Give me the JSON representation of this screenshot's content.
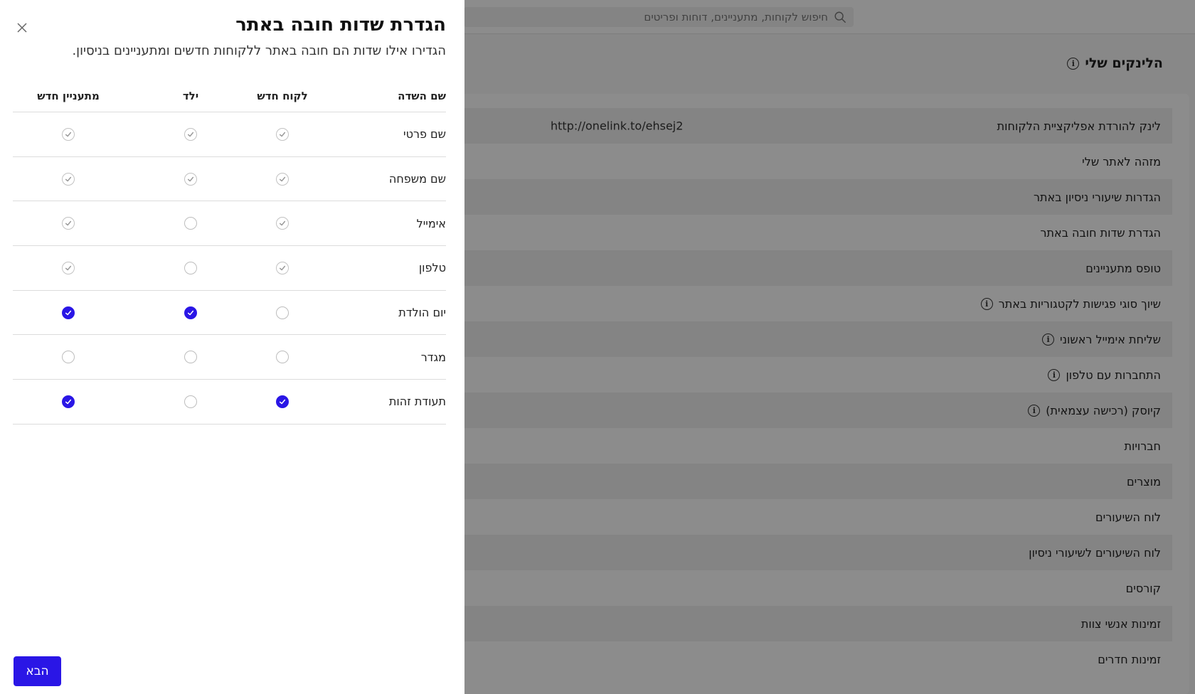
{
  "search": {
    "placeholder": "חיפוש לקוחות, מתעניינים, דוחות ופריטים"
  },
  "background": {
    "heading": "הלינקים שלי",
    "rows": [
      {
        "label": "לינק להורדת אפליקציית הלקוחות",
        "value": "http://onelink.to/ehsej2",
        "info": false
      },
      {
        "label": "מזהה לאתר שלי",
        "value": "",
        "info": false
      },
      {
        "label": "הגדרות שיעורי ניסיון באתר",
        "value": "",
        "info": false
      },
      {
        "label": "הגדרת שדות חובה באתר",
        "value": "",
        "info": false
      },
      {
        "label": "טופס מתעניינים",
        "value": "",
        "info": false
      },
      {
        "label": "שיוך סוגי פגישות לקטגוריות באתר",
        "value": "",
        "info": true
      },
      {
        "label": "שליחת אימייל ראשוני",
        "value": "",
        "info": true
      },
      {
        "label": "התחברות עם טלפון",
        "value": "",
        "info": true
      },
      {
        "label": "קיוסק (רכישה עצמאית)",
        "value": "",
        "info": true
      },
      {
        "label": "חברויות",
        "value": "",
        "info": false
      },
      {
        "label": "מוצרים",
        "value": "",
        "info": false
      },
      {
        "label": "לוח השיעורים",
        "value": "",
        "info": false
      },
      {
        "label": "לוח השיעורים לשיעורי ניסיון",
        "value": "",
        "info": false
      },
      {
        "label": "קורסים",
        "value": "",
        "info": false
      },
      {
        "label": "זמינות אנשי צוות",
        "value": "",
        "info": false
      },
      {
        "label": "זמינות חדרים",
        "value": "",
        "info": false
      }
    ]
  },
  "drawer": {
    "title": "הגדרת שדות חובה באתר",
    "subtitle": "הגדירו אילו שדות הם חובה באתר ללקוחות חדשים ומתעניינים בניסיון.",
    "columns": {
      "name": "שם השדה",
      "new_customer": "לקוח חדש",
      "child": "ילד",
      "new_lead": "מתעניין חדש"
    },
    "fields": [
      {
        "name": "שם פרטי",
        "new_customer": "locked",
        "child": "locked",
        "new_lead": "locked"
      },
      {
        "name": "שם משפחה",
        "new_customer": "locked",
        "child": "locked",
        "new_lead": "locked"
      },
      {
        "name": "אימייל",
        "new_customer": "locked",
        "child": "off",
        "new_lead": "locked"
      },
      {
        "name": "טלפון",
        "new_customer": "locked",
        "child": "off",
        "new_lead": "locked"
      },
      {
        "name": "יום הולדת",
        "new_customer": "off",
        "child": "on",
        "new_lead": "on"
      },
      {
        "name": "מגדר",
        "new_customer": "off",
        "child": "off",
        "new_lead": "off"
      },
      {
        "name": "תעודת זהות",
        "new_customer": "on",
        "child": "off",
        "new_lead": "on"
      }
    ],
    "next_label": "הבא"
  },
  "colors": {
    "accent": "#2a16e6",
    "overlay": "rgba(0,0,0,0.45)"
  },
  "icons": {
    "close": "close-icon",
    "search": "search-icon",
    "info": "info-icon",
    "check": "check-icon"
  }
}
